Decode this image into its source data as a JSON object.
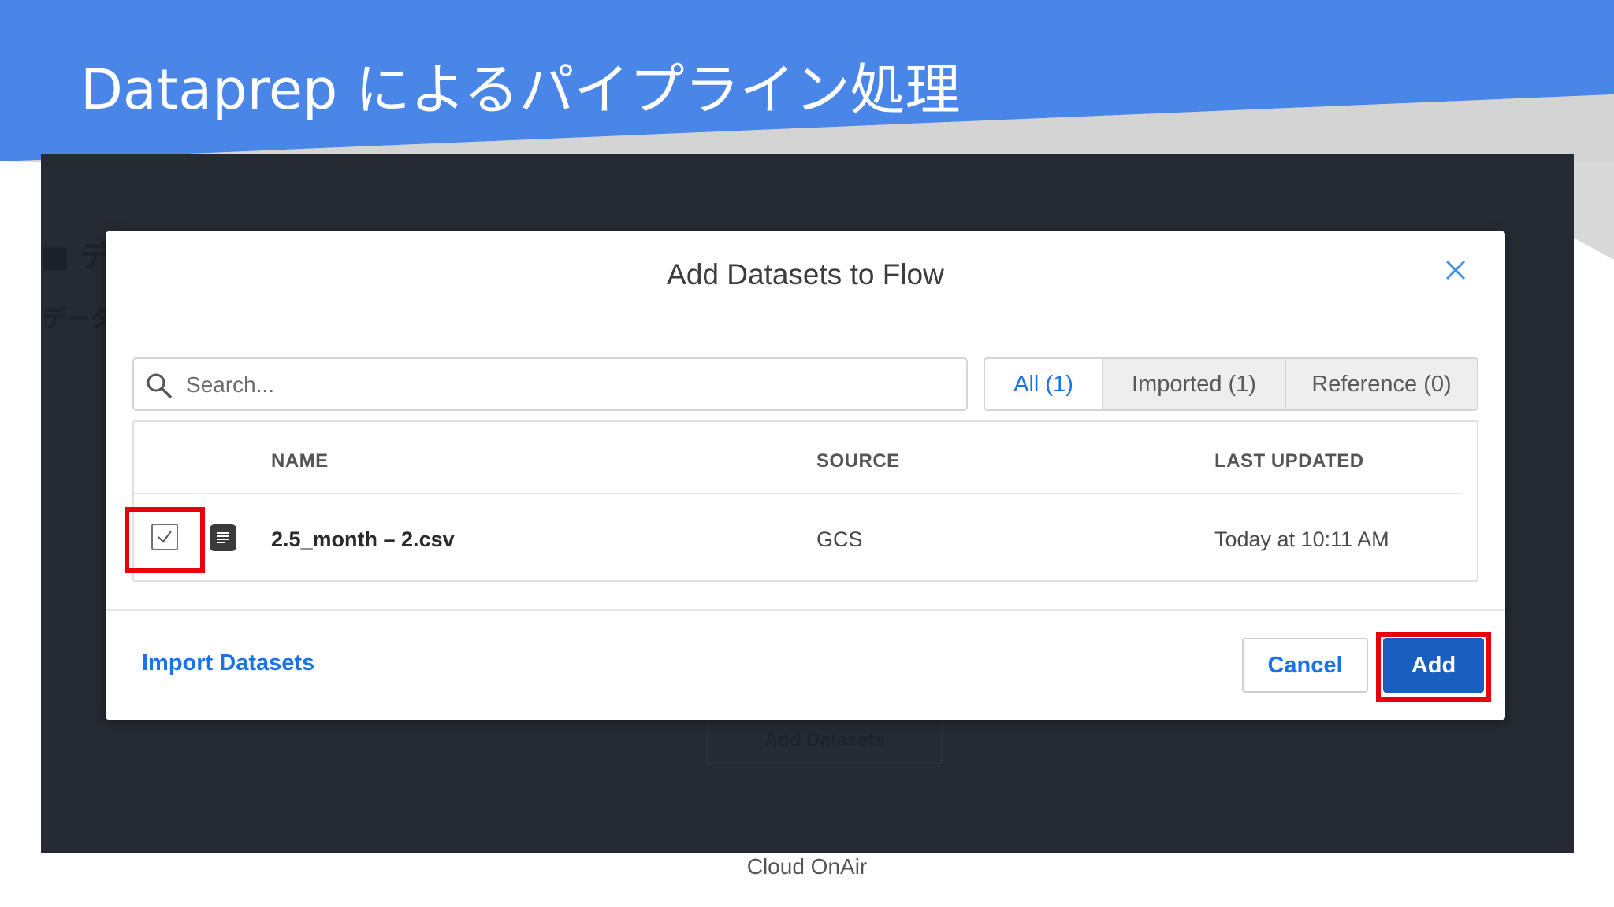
{
  "slide": {
    "title": "Dataprep によるパイプライン処理",
    "footer": "Cloud OnAir",
    "colors": {
      "header_blue": "#4a86e8",
      "highlight_red": "#e8000b"
    }
  },
  "background_app": {
    "ghost_texts": [
      "■ デー",
      "データ"
    ],
    "button_label": "Add Datasets"
  },
  "dialog": {
    "title": "Add Datasets to Flow",
    "close_icon": "close-x-icon",
    "search": {
      "placeholder": "Search...",
      "value": ""
    },
    "tabs": [
      {
        "label": "All (1)",
        "active": true
      },
      {
        "label": "Imported (1)",
        "active": false
      },
      {
        "label": "Reference (0)",
        "active": false
      }
    ],
    "table": {
      "columns": [
        "NAME",
        "SOURCE",
        "LAST UPDATED"
      ],
      "rows": [
        {
          "checked": true,
          "icon": "file-document-icon",
          "name": "2.5_month – 2.csv",
          "source": "GCS",
          "last_updated": "Today at 10:11 AM"
        }
      ]
    },
    "footer": {
      "import_link": "Import Datasets",
      "cancel_label": "Cancel",
      "add_label": "Add"
    },
    "colors": {
      "link_blue": "#1a73e8",
      "primary_button": "#1a5fbf"
    }
  }
}
